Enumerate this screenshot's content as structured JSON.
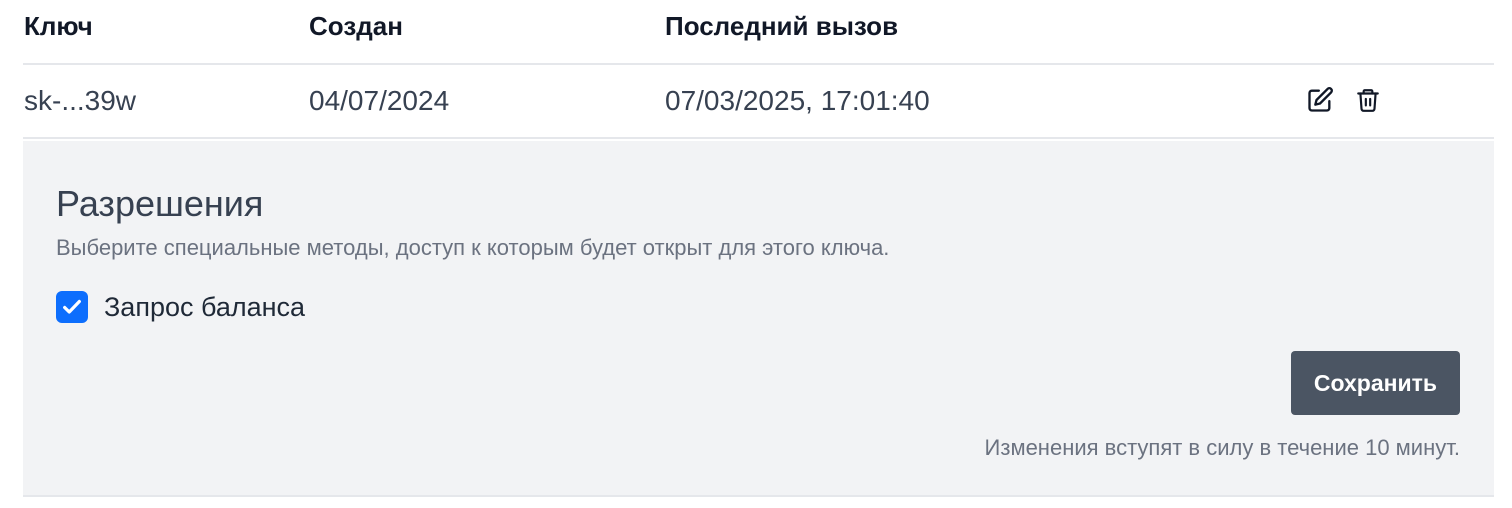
{
  "table": {
    "headers": {
      "key": "Ключ",
      "created": "Создан",
      "last_call": "Последний вызов"
    },
    "rows": [
      {
        "key": "sk-...39w",
        "created": "04/07/2024",
        "last_call": "07/03/2025, 17:01:40",
        "actions": [
          "pencil-icon",
          "trash-icon"
        ]
      }
    ]
  },
  "permissions_panel": {
    "title": "Разрешения",
    "description": "Выберите специальные методы, доступ к которым будет открыт для этого ключа.",
    "items": [
      {
        "label": "Запрос баланса",
        "checked": true
      }
    ],
    "save_label": "Сохранить",
    "note": "Изменения вступят в силу в течение 10 минут."
  },
  "colors": {
    "accent": "#0d6efd",
    "button_bg": "#4b5563",
    "panel_bg": "#f2f3f5"
  }
}
